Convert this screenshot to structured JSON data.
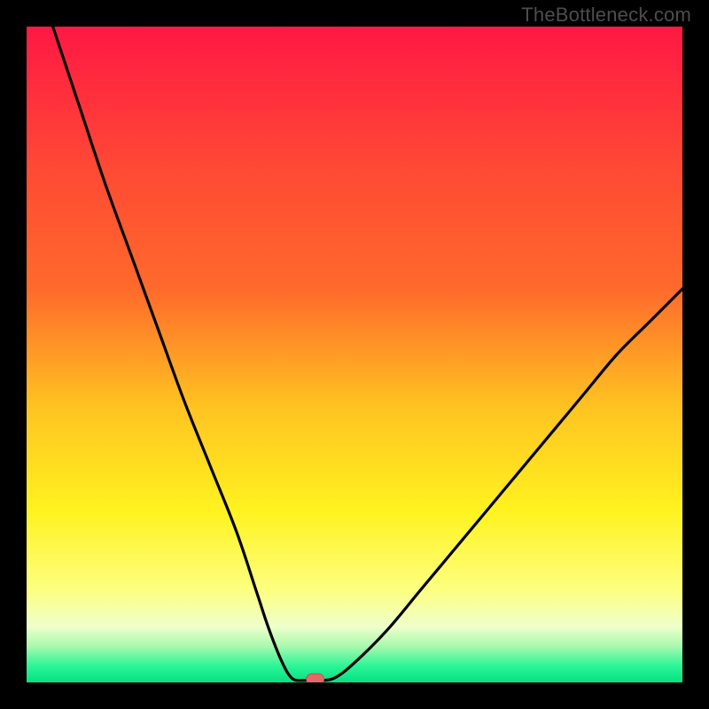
{
  "watermark": "TheBottleneck.com",
  "chart_data": {
    "type": "line",
    "title": "",
    "xlabel": "",
    "ylabel": "",
    "xlim": [
      0,
      100
    ],
    "ylim": [
      0,
      100
    ],
    "curve_left": {
      "x": [
        4,
        8,
        12,
        16,
        20,
        24,
        28,
        32,
        35,
        37,
        39,
        40.5,
        42
      ],
      "y": [
        100,
        88,
        76,
        65,
        54,
        43,
        33,
        23,
        14,
        8,
        3,
        0.6,
        0.3
      ]
    },
    "curve_right": {
      "x": [
        45,
        47,
        50,
        55,
        60,
        65,
        70,
        75,
        80,
        85,
        90,
        95,
        100
      ],
      "y": [
        0.3,
        0.7,
        3,
        8,
        14,
        20,
        26,
        32,
        38,
        44,
        50,
        55,
        60
      ]
    },
    "marker": {
      "x": 44,
      "y": 0.5
    },
    "colors": {
      "gradient_top": "#ff1844",
      "gradient_mid1": "#ff6a2b",
      "gradient_mid2": "#ffc321",
      "gradient_mid3": "#fff320",
      "gradient_low": "#fdff81",
      "gradient_pale": "#eeffcb",
      "gradient_green1": "#a8f9ad",
      "gradient_green2": "#2bf597",
      "gradient_green3": "#05e181",
      "curve": "#000000",
      "marker_fill": "#e06a6a",
      "marker_stroke": "#c94f4f"
    }
  }
}
